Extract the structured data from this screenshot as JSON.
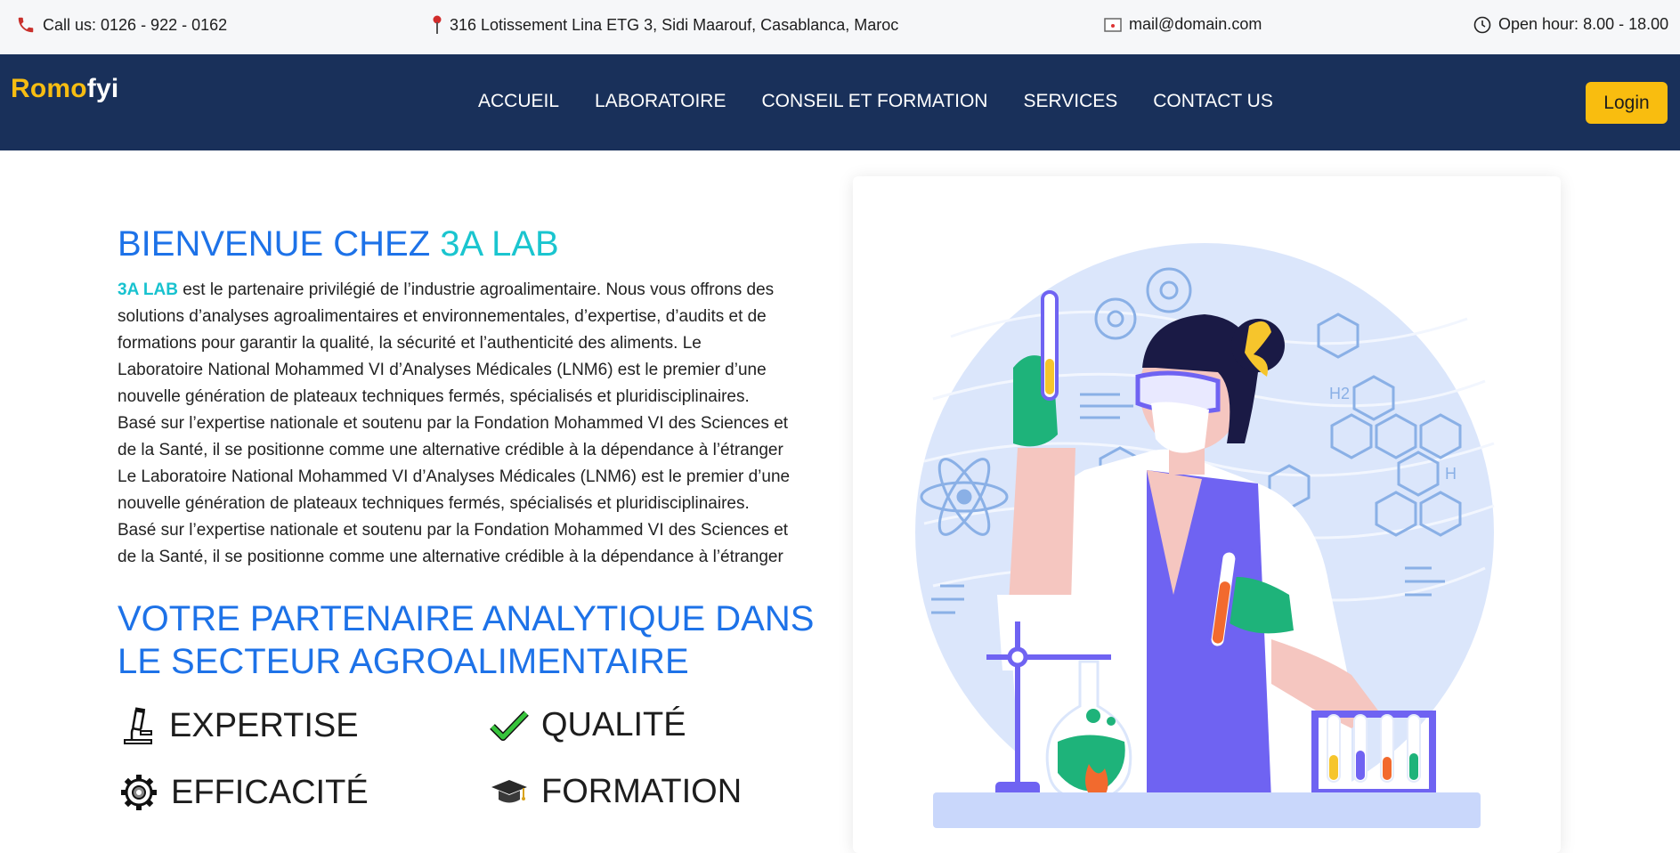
{
  "topbar": {
    "phone": "Call us: 0126 - 922 - 0162",
    "address": "316 Lotissement Lina ETG 3, Sidi Maarouf, Casablanca, Maroc",
    "email": "mail@domain.com",
    "hours": "Open hour: 8.00 - 18.00"
  },
  "brand": {
    "part1": "Romo",
    "part2": "fyi",
    "color1": "#f7bd12",
    "color2": "#ffffff"
  },
  "nav": {
    "items": [
      "ACCUEIL",
      "LABORATOIRE",
      "CONSEIL ET FORMATION",
      "SERVICES",
      "CONTACT US"
    ],
    "login": "Login"
  },
  "welcome": {
    "prefix": "BIENVENUE CHEZ ",
    "highlight": "3A LAB"
  },
  "intro": {
    "brand": "3A LAB",
    "first_line_rest": " est le partenaire privilégié de l’industrie agroalimentaire. Nous vous offrons des",
    "lines": [
      "solutions d’analyses agroalimentaires et environnementales, d’expertise, d’audits et de",
      "formations pour garantir la qualité, la sécurité et l’authenticité des aliments. Le",
      "Laboratoire National Mohammed VI d’Analyses Médicales (LNM6) est le premier d’une",
      "nouvelle génération de plateaux techniques fermés, spécialisés et pluridisciplinaires.",
      "Basé sur l’expertise nationale et soutenu par la Fondation Mohammed VI des Sciences et",
      "de la Santé, il se positionne comme une alternative crédible à la dépendance à l’étranger",
      "Le Laboratoire National Mohammed VI d’Analyses Médicales (LNM6) est le premier d’une",
      "nouvelle génération de plateaux techniques fermés, spécialisés et pluridisciplinaires.",
      "Basé sur l’expertise nationale et soutenu par la Fondation Mohammed VI des Sciences et",
      "de la Santé, il se positionne comme une alternative crédible à la dépendance à l’étranger"
    ]
  },
  "partner": {
    "line1": "VOTRE PARTENAIRE ANALYTIQUE DANS",
    "line2": "LE SECTEUR AGROALIMENTAIRE"
  },
  "features": [
    {
      "label": "EXPERTISE",
      "icon": "microscope-icon"
    },
    {
      "label": "QUALITÉ",
      "icon": "checkmark-icon"
    },
    {
      "label": "EFFICACITÉ",
      "icon": "gear-icon"
    },
    {
      "label": "FORMATION",
      "icon": "graduation-cap-icon"
    }
  ],
  "illustration": {
    "h2_label": "H2",
    "h_label": "H"
  },
  "colors": {
    "topbar_bg": "#f6f7f9",
    "nav_bg": "#19305a",
    "accent_yellow": "#f9bd0f",
    "heading_blue": "#1d72e8",
    "highlight_teal": "#1ac5cf"
  }
}
